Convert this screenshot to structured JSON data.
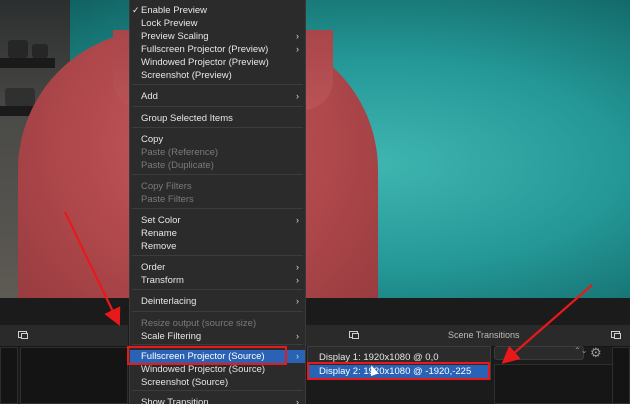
{
  "context_menu": {
    "items": [
      {
        "label": "Enable Preview",
        "checked": true
      },
      {
        "label": "Lock Preview"
      },
      {
        "label": "Preview Scaling",
        "submenu": true
      },
      {
        "label": "Fullscreen Projector (Preview)",
        "submenu": true
      },
      {
        "label": "Windowed Projector (Preview)"
      },
      {
        "label": "Screenshot (Preview)"
      },
      {
        "label": "Add",
        "submenu": true
      },
      {
        "label": "Group Selected Items"
      },
      {
        "label": "Copy"
      },
      {
        "label": "Paste (Reference)",
        "disabled": true
      },
      {
        "label": "Paste (Duplicate)",
        "disabled": true
      },
      {
        "label": "Copy Filters",
        "disabled": true
      },
      {
        "label": "Paste Filters",
        "disabled": true
      },
      {
        "label": "Set Color",
        "submenu": true
      },
      {
        "label": "Rename"
      },
      {
        "label": "Remove"
      },
      {
        "label": "Order",
        "submenu": true
      },
      {
        "label": "Transform",
        "submenu": true
      },
      {
        "label": "Deinterlacing",
        "submenu": true
      },
      {
        "label": "Resize output (source size)",
        "disabled": true
      },
      {
        "label": "Scale Filtering",
        "submenu": true
      },
      {
        "label": "Fullscreen Projector (Source)",
        "submenu": true,
        "highlighted": true
      },
      {
        "label": "Windowed Projector (Source)"
      },
      {
        "label": "Screenshot (Source)"
      },
      {
        "label": "Show Transition",
        "submenu": true
      }
    ],
    "check_mark": "✓",
    "submenu_arrow": "›"
  },
  "projector_submenu": {
    "items": [
      {
        "label": "Display 1: 1920x1080 @ 0,0"
      },
      {
        "label": "Display 2: 1920x1080 @ -1920,-225",
        "highlighted": true
      }
    ]
  },
  "dock": {
    "scene_transitions_title": "Scene Transitions",
    "combo_arrows": "⌃⌄",
    "settings_icon": "gear-icon"
  },
  "colors": {
    "highlight": "#2a62b6",
    "annotation_red": "#e8191b",
    "menu_bg": "#2b2b2b"
  }
}
